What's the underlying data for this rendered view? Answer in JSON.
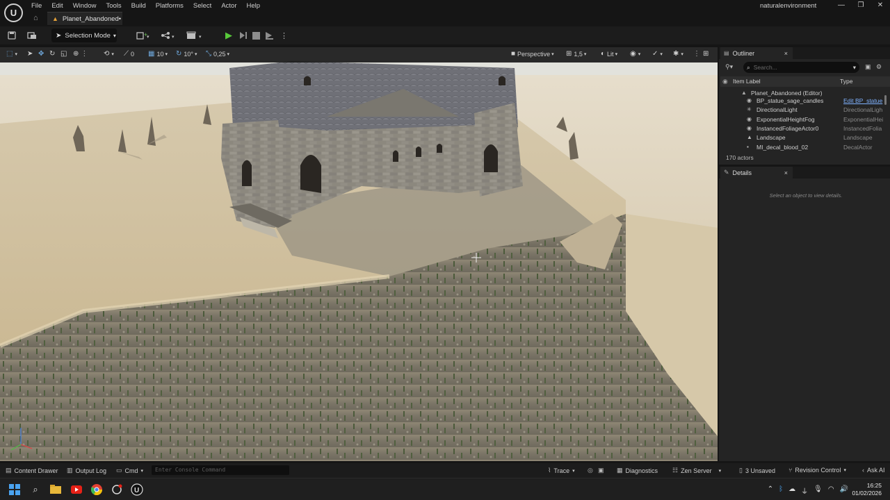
{
  "window": {
    "project": "naturalenvironment",
    "level_tab": "Planet_Abandoned•",
    "controls": [
      "—",
      "❐",
      "✕"
    ]
  },
  "menu": [
    "File",
    "Edit",
    "Window",
    "Tools",
    "Build",
    "Platforms",
    "Select",
    "Actor",
    "Help"
  ],
  "toolbar": {
    "selection_mode": "Selection Mode"
  },
  "viewport_toolbar": {
    "translate_snap": "0",
    "grid_snap": "10",
    "rotate_snap": "10°",
    "scale_snap": "0,25",
    "view_mode": "Perspective",
    "camera_speed": "1,5",
    "lighting": "Lit"
  },
  "outliner": {
    "tab": "Outliner",
    "search_placeholder": "Search...",
    "col_label": "Item Label",
    "col_type": "Type",
    "root": "Planet_Abandoned (Editor)",
    "rows": [
      {
        "name": "BP_statue_sage_candles",
        "type": "Edit BP_statue",
        "icon": "blueprint-icon"
      },
      {
        "name": "DirectionalLight",
        "type": "DirectionalLigh",
        "icon": "light-icon"
      },
      {
        "name": "ExponentialHeightFog",
        "type": "ExponentialHei",
        "icon": "fog-icon"
      },
      {
        "name": "InstancedFoliageActor0",
        "type": "InstancedFolia",
        "icon": "foliage-icon"
      },
      {
        "name": "Landscape",
        "type": "Landscape",
        "icon": "landscape-icon"
      },
      {
        "name": "MI_decal_blood_02",
        "type": "DecalActor",
        "icon": "decal-icon"
      }
    ],
    "actor_count": "170 actors"
  },
  "details": {
    "tab": "Details",
    "empty_message": "Select an object to view details."
  },
  "statusbar": {
    "content_drawer": "Content Drawer",
    "output_log": "Output Log",
    "cmd": "Cmd",
    "console_placeholder": "Enter Console Command",
    "trace": "Trace",
    "diagnostics": "Diagnostics",
    "zen_server": "Zen Server",
    "unsaved": "3 Unsaved",
    "revision_control": "Revision Control",
    "ask_ai": "Ask AI"
  },
  "taskbar": {
    "time": "16:25",
    "date": "01/02/2026"
  }
}
